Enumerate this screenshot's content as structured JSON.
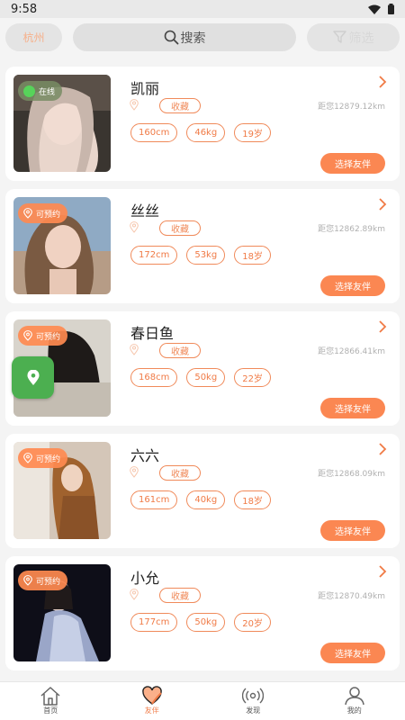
{
  "status": {
    "time": "9:58"
  },
  "header": {
    "city": "杭州",
    "search_label": "搜索",
    "filter_label": "筛选"
  },
  "cards": [
    {
      "name": "凯丽",
      "badge": "在线",
      "fav": "收藏",
      "distance": "距您12879.12km",
      "tags": [
        "160cm",
        "46kg",
        "19岁"
      ],
      "button": "选择友伴"
    },
    {
      "name": "丝丝",
      "badge": "可预约",
      "fav": "收藏",
      "distance": "距您12862.89km",
      "tags": [
        "172cm",
        "53kg",
        "18岁"
      ],
      "button": "选择友伴"
    },
    {
      "name": "春日鱼",
      "badge": "可预约",
      "fav": "收藏",
      "distance": "距您12866.41km",
      "tags": [
        "168cm",
        "50kg",
        "22岁"
      ],
      "button": "选择友伴"
    },
    {
      "name": "六六",
      "badge": "可预约",
      "fav": "收藏",
      "distance": "距您12868.09km",
      "tags": [
        "161cm",
        "40kg",
        "18岁"
      ],
      "button": "选择友伴"
    },
    {
      "name": "小允",
      "badge": "可预约",
      "fav": "收藏",
      "distance": "距您12870.49km",
      "tags": [
        "177cm",
        "50kg",
        "20岁"
      ],
      "button": "选择友伴"
    }
  ],
  "tabs": [
    {
      "label": "首页",
      "icon": "home-icon",
      "active": false
    },
    {
      "label": "友伴",
      "icon": "heart-icon",
      "active": true
    },
    {
      "label": "发现",
      "icon": "broadcast-icon",
      "active": false
    },
    {
      "label": "我的",
      "icon": "user-icon",
      "active": false
    }
  ],
  "colors": {
    "accent": "#fb8752",
    "online": "#57d35a",
    "fab": "#4caf50"
  }
}
